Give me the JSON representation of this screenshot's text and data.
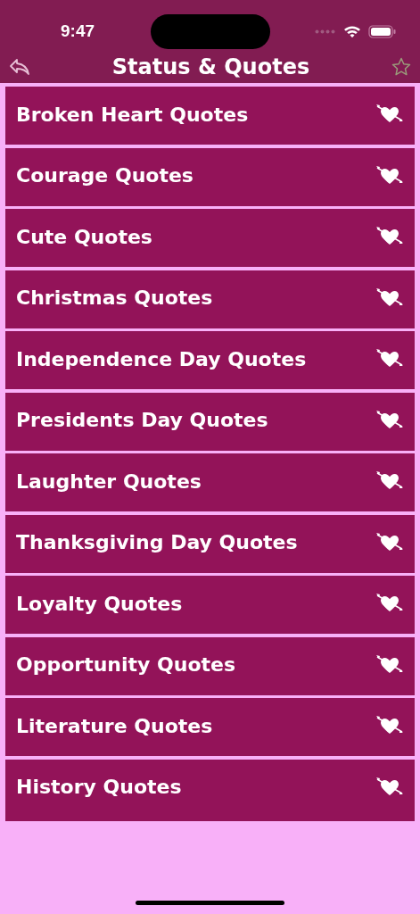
{
  "status_bar": {
    "time": "9:47"
  },
  "nav_bar": {
    "title": "Status & Quotes"
  },
  "categories": [
    {
      "label": "Broken Heart Quotes"
    },
    {
      "label": "Courage Quotes"
    },
    {
      "label": "Cute Quotes"
    },
    {
      "label": "Christmas Quotes"
    },
    {
      "label": "Independence Day Quotes"
    },
    {
      "label": "Presidents Day Quotes"
    },
    {
      "label": "Laughter Quotes"
    },
    {
      "label": "Thanksgiving Day Quotes"
    },
    {
      "label": "Loyalty Quotes"
    },
    {
      "label": "Opportunity Quotes"
    },
    {
      "label": "Literature Quotes"
    },
    {
      "label": "History Quotes"
    }
  ]
}
